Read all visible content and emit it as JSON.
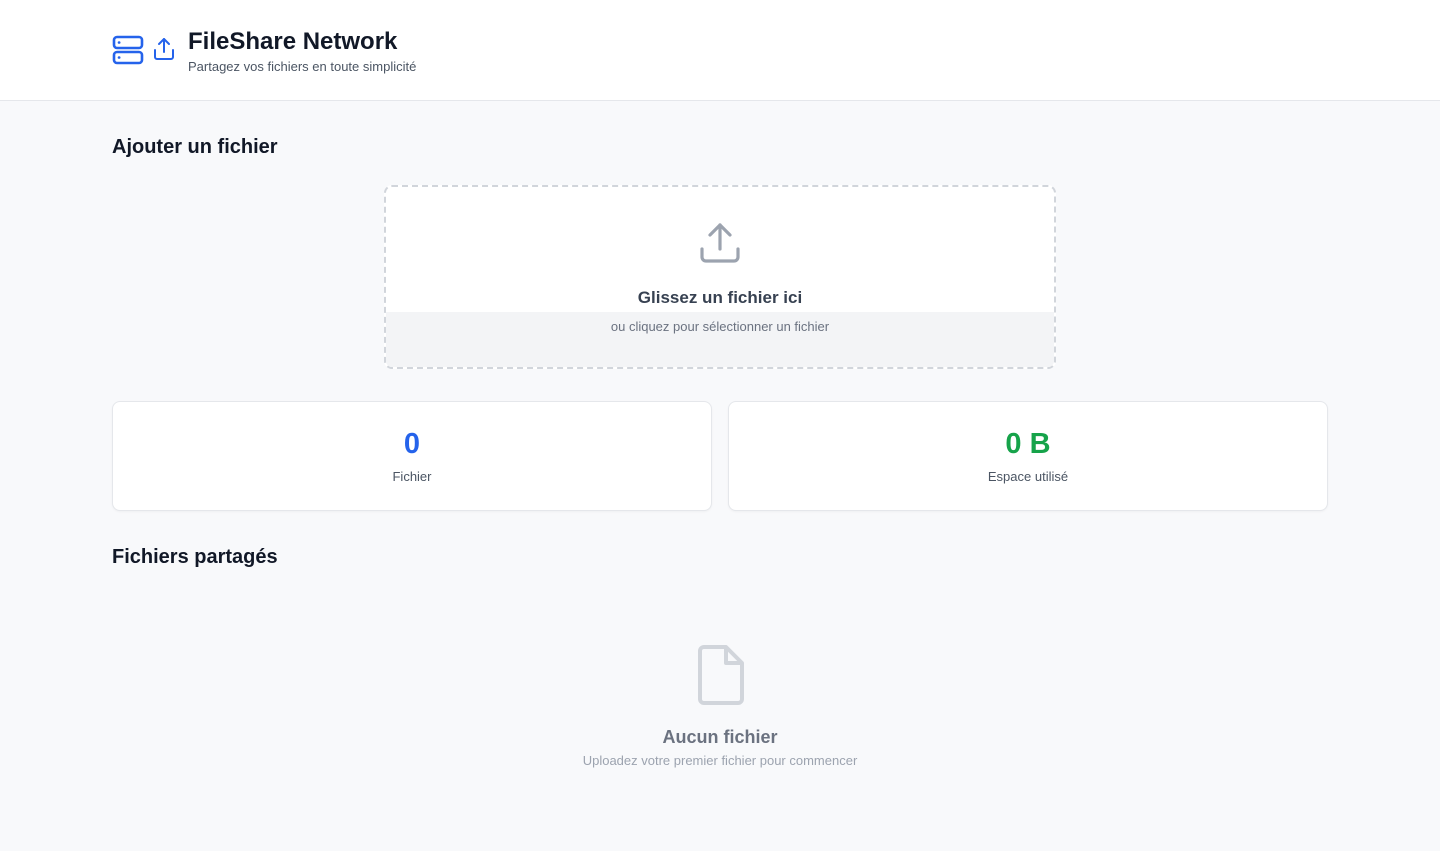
{
  "header": {
    "title": "FileShare Network",
    "subtitle": "Partagez vos fichiers en toute simplicité",
    "icons": [
      "server-icon",
      "share-upload-icon"
    ]
  },
  "upload_section": {
    "title": "Ajouter un fichier",
    "dropzone": {
      "icon": "upload-icon",
      "title": "Glissez un fichier ici",
      "subtitle": "ou cliquez pour sélectionner un fichier"
    }
  },
  "stats": {
    "files": {
      "value": "0",
      "label": "Fichier",
      "color": "#2563eb"
    },
    "space": {
      "value": "0 B",
      "label": "Espace utilisé",
      "color": "#16a34a"
    }
  },
  "shared_section": {
    "title": "Fichiers partagés",
    "empty_state": {
      "icon": "file-icon",
      "title": "Aucun fichier",
      "subtitle": "Uploadez votre premier fichier pour commencer"
    }
  },
  "colors": {
    "accent": "#2563eb",
    "success": "#16a34a",
    "background": "#f8f9fb"
  }
}
